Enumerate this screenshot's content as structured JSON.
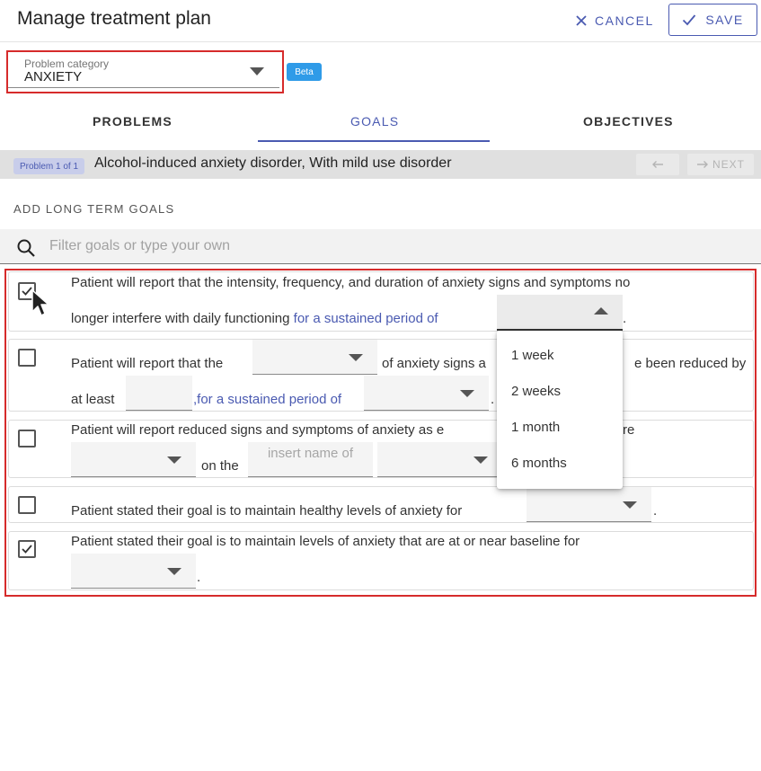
{
  "header": {
    "title": "Manage treatment plan",
    "cancel_label": "CANCEL",
    "save_label": "SAVE"
  },
  "problem_category": {
    "label": "Problem category",
    "value": "ANXIETY",
    "badge": "Beta"
  },
  "tabs": [
    {
      "label": "PROBLEMS"
    },
    {
      "label": "GOALS",
      "active": true
    },
    {
      "label": "OBJECTIVES"
    }
  ],
  "problem_bar": {
    "chip": "Problem 1 of 1",
    "title": "Alcohol-induced anxiety disorder, With mild use disorder",
    "next_label": "NEXT"
  },
  "section_title": "ADD LONG TERM GOALS",
  "search": {
    "placeholder": "Filter goals or type your own"
  },
  "goals": [
    {
      "checked": true,
      "line1": "Patient will report that the intensity, frequency, and duration of anxiety signs and symptoms no",
      "line2": "longer interfere with daily functioning",
      "link": "for a sustained period of",
      "end": "."
    },
    {
      "checked": false,
      "line1a": "Patient will report that the",
      "line1b": "of anxiety signs a",
      "line1c": "e been reduced by",
      "line2a": "at least",
      "link": ",for a sustained period of",
      "end": "."
    },
    {
      "checked": false,
      "line1a": "Patient will report reduced signs and symptoms of anxiety as e",
      "line1b": "re",
      "on_the": "on the",
      "insert_placeholder": "insert name of"
    },
    {
      "checked": false,
      "line1": "Patient stated their goal is to maintain healthy levels of anxiety for",
      "end": "."
    },
    {
      "checked": true,
      "line1": "Patient stated their goal is to maintain levels of anxiety that are at or near baseline for",
      "end": "."
    }
  ],
  "dropdown": {
    "options": [
      "1 week",
      "2 weeks",
      "1 month",
      "6 months"
    ]
  },
  "colors": {
    "accent": "#4a5ab1",
    "highlight_border": "#d62b2b",
    "beta": "#2f9be8"
  }
}
